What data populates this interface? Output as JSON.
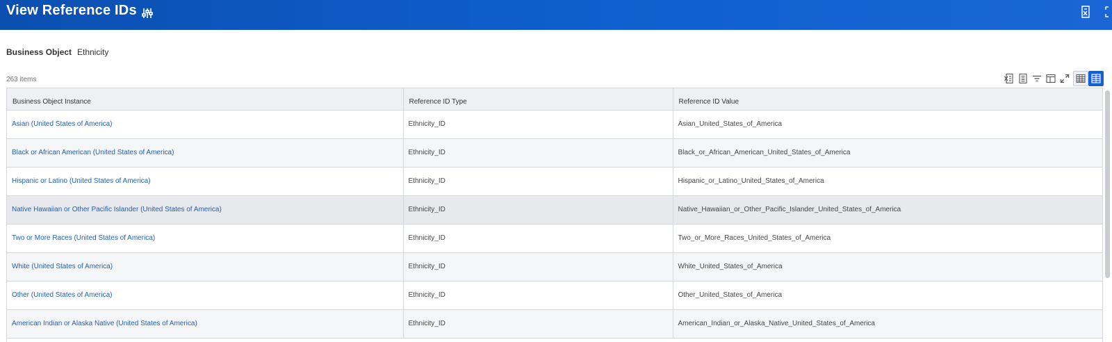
{
  "header": {
    "title": "View Reference IDs"
  },
  "business_object": {
    "label": "Business Object",
    "value": "Ethnicity"
  },
  "item_count": "263 items",
  "table": {
    "columns": [
      "Business Object Instance",
      "Reference ID Type",
      "Reference ID Value"
    ],
    "rows": [
      {
        "instance": "Asian (United States of America)",
        "type": "Ethnicity_ID",
        "value": "Asian_United_States_of_America"
      },
      {
        "instance": "Black or African American (United States of America)",
        "type": "Ethnicity_ID",
        "value": "Black_or_African_American_United_States_of_America"
      },
      {
        "instance": "Hispanic or Latino (United States of America)",
        "type": "Ethnicity_ID",
        "value": "Hispanic_or_Latino_United_States_of_America"
      },
      {
        "instance": "Native Hawaiian or Other Pacific Islander (United States of America)",
        "type": "Ethnicity_ID",
        "value": "Native_Hawaiian_or_Other_Pacific_Islander_United_States_of_America"
      },
      {
        "instance": "Two or More Races (United States of America)",
        "type": "Ethnicity_ID",
        "value": "Two_or_More_Races_United_States_of_America"
      },
      {
        "instance": "White (United States of America)",
        "type": "Ethnicity_ID",
        "value": "White_United_States_of_America"
      },
      {
        "instance": "Other (United States of America)",
        "type": "Ethnicity_ID",
        "value": "Other_United_States_of_America"
      },
      {
        "instance": "American Indian or Alaska Native (United States of America)",
        "type": "Ethnicity_ID",
        "value": "American_Indian_or_Alaska_Native_United_States_of_America"
      }
    ]
  },
  "icons": {
    "header_related": "sliders-icon",
    "header_export": "export-excel-icon",
    "header_fullscreen": "fullscreen-icon",
    "toolbar": [
      "export-excel-icon",
      "export-pdf-icon",
      "filter-icon",
      "column-layout-icon",
      "expand-icon",
      "table-view-icon",
      "grid-view-icon"
    ]
  },
  "colors": {
    "header_blue": "#0f5fd0",
    "link_blue": "#1f5fb4",
    "active_toggle": "#1460d0"
  }
}
